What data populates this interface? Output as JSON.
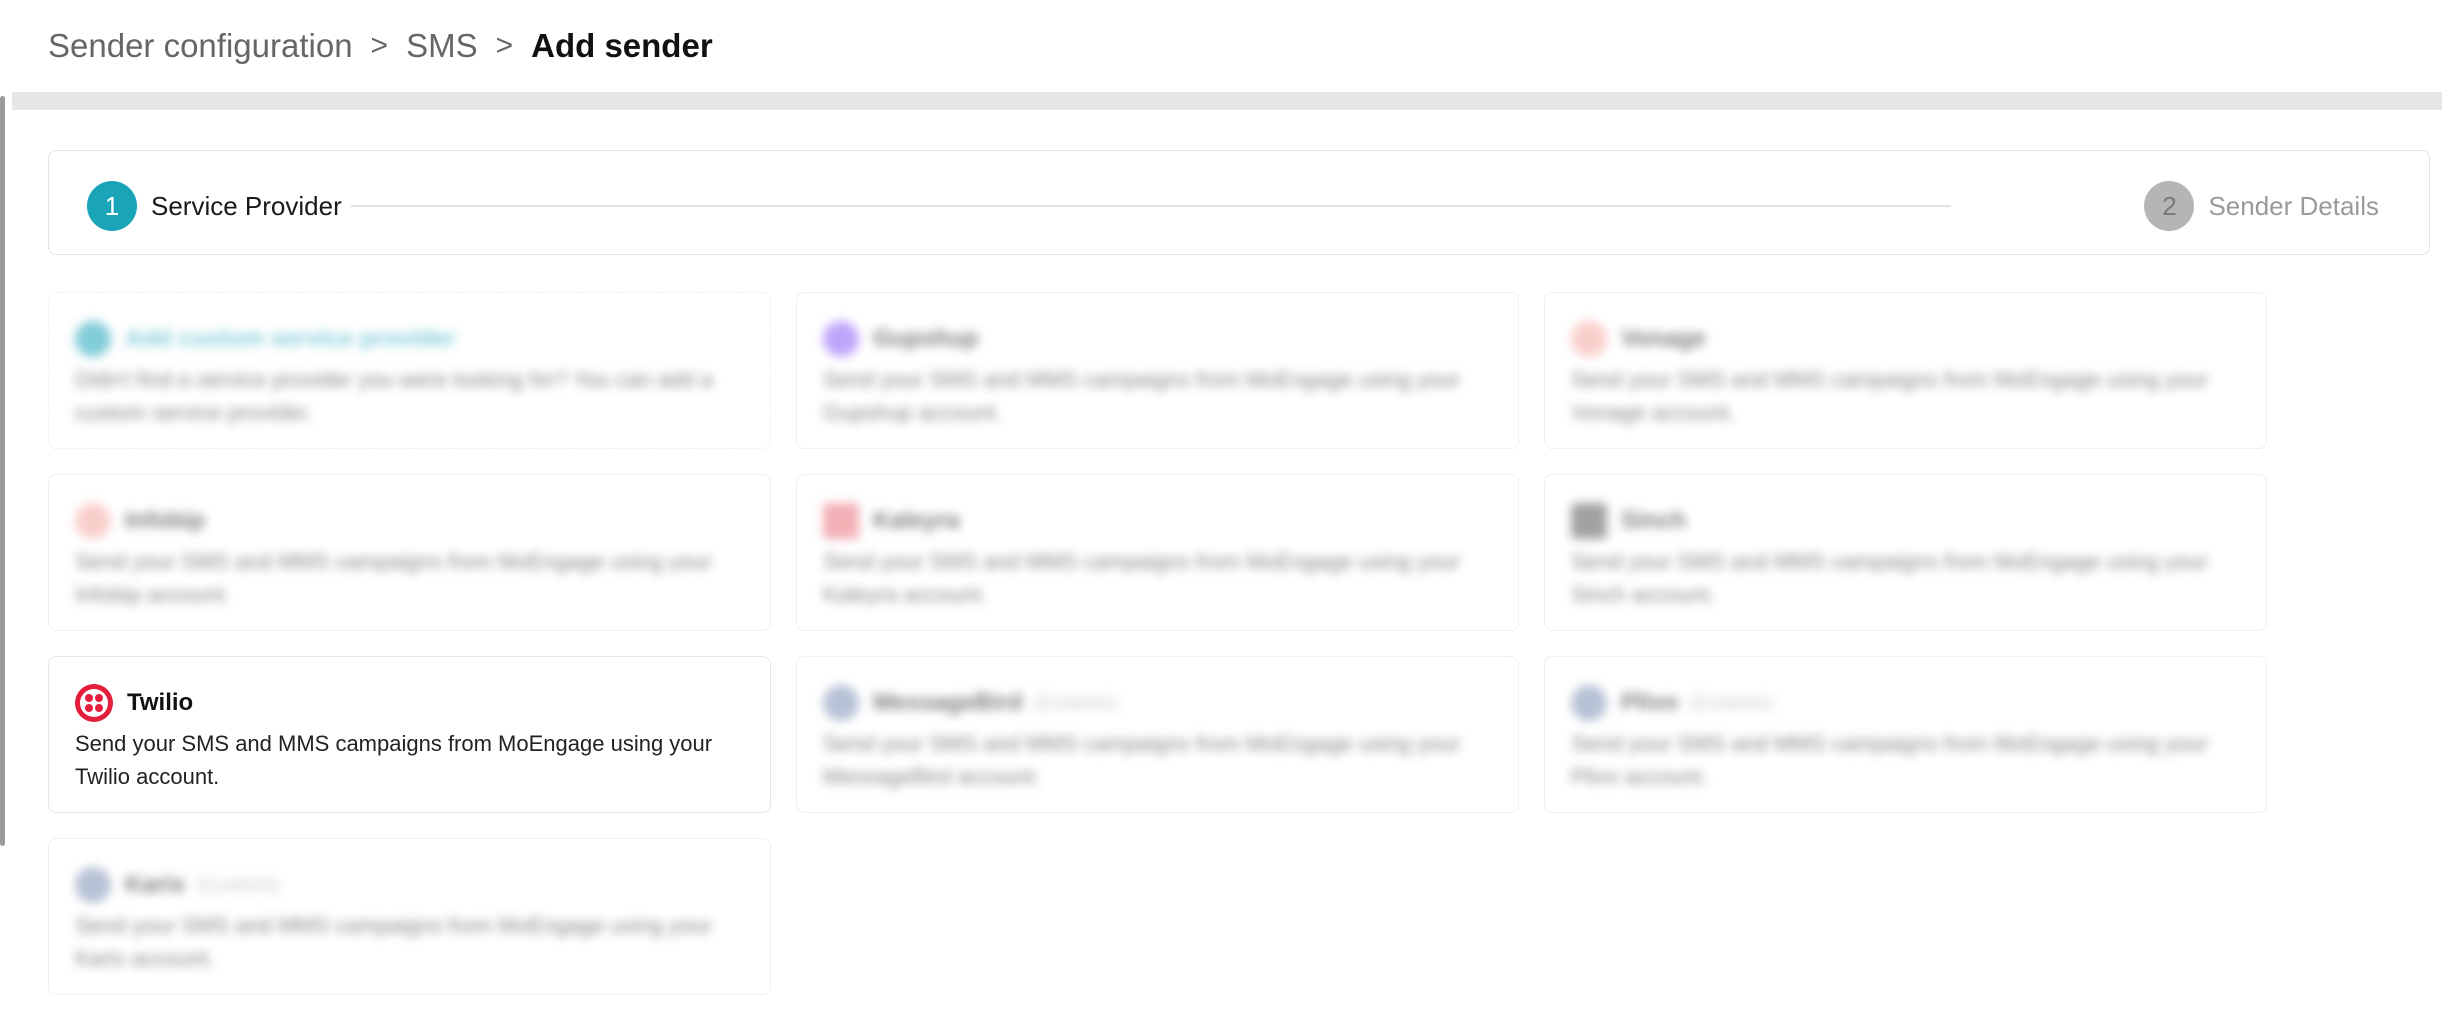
{
  "breadcrumb": {
    "items": [
      "Sender configuration",
      "SMS",
      "Add sender"
    ],
    "separator": ">"
  },
  "stepper": {
    "steps": [
      {
        "number": "1",
        "label": "Service Provider",
        "state": "active"
      },
      {
        "number": "2",
        "label": "Sender Details",
        "state": "inactive"
      }
    ]
  },
  "colors": {
    "accent": "#1aa4b8",
    "twilio_red": "#e31e3b",
    "inactive_step": "#b5b5b5"
  },
  "providers": [
    {
      "name": "Add custom service provider",
      "tag": "",
      "description": "Didn't find a service provider you were looking for? You can add a custom service provider.",
      "logo_color": "#1aa4b8",
      "blurred": true,
      "icon": "plus-icon"
    },
    {
      "name": "Gupshup",
      "tag": "",
      "description": "Send your SMS and MMS campaigns from MoEngage using your Gupshup account.",
      "logo_color": "#8b5cf6",
      "blurred": true,
      "icon": "gupshup-logo-icon"
    },
    {
      "name": "Vonage",
      "tag": "",
      "description": "Send your SMS and MMS campaigns from MoEngage using your Vonage account.",
      "logo_color": "#f4a7a0",
      "blurred": true,
      "icon": "vonage-logo-icon"
    },
    {
      "name": "Infobip",
      "tag": "",
      "description": "Send your SMS and MMS campaigns from MoEngage using your Infobip account.",
      "logo_color": "#f4a7a0",
      "blurred": true,
      "icon": "infobip-logo-icon"
    },
    {
      "name": "Kaleyra",
      "tag": "",
      "description": "Send your SMS and MMS campaigns from MoEngage using your Kaleyra account.",
      "logo_color": "#e8707a",
      "blurred": true,
      "icon": "kaleyra-logo-icon"
    },
    {
      "name": "Sinch",
      "tag": "",
      "description": "Send your SMS and MMS campaigns from MoEngage using your Sinch account.",
      "logo_color": "#555555",
      "blurred": true,
      "icon": "sinch-logo-icon"
    },
    {
      "name": "Twilio",
      "tag": "",
      "description": "Send your SMS and MMS campaigns from MoEngage using your Twilio account.",
      "logo_color": "#e31e3b",
      "blurred": false,
      "icon": "twilio-logo-icon"
    },
    {
      "name": "MessageBird",
      "tag": "(Custom)",
      "description": "Send your SMS and MMS campaigns from MoEngage using your MessageBird account.",
      "logo_color": "#7a8fb3",
      "blurred": true,
      "icon": "provider-logo-icon"
    },
    {
      "name": "Plivo",
      "tag": "(Custom)",
      "description": "Send your SMS and MMS campaigns from MoEngage using your Plivo account.",
      "logo_color": "#7a8fb3",
      "blurred": true,
      "icon": "provider-logo-icon"
    },
    {
      "name": "Karix",
      "tag": "(Custom)",
      "description": "Send your SMS and MMS campaigns from MoEngage using your Karix account.",
      "logo_color": "#7a8fb3",
      "blurred": true,
      "icon": "provider-logo-icon"
    }
  ]
}
